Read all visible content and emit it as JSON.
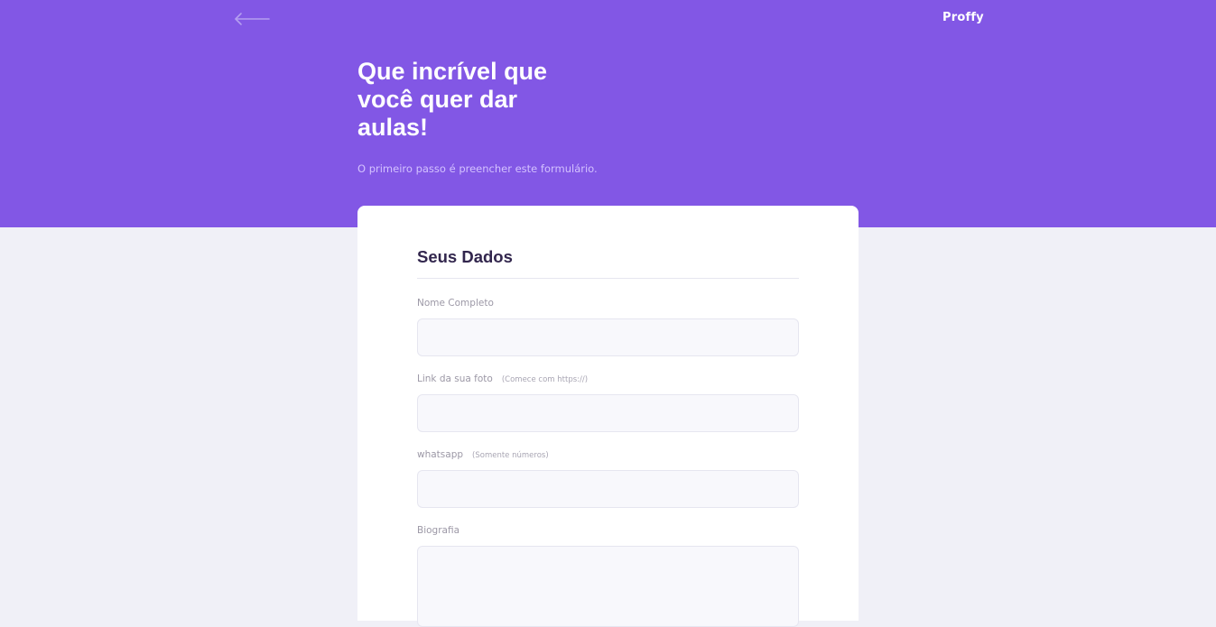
{
  "header": {
    "logo": "Proffy",
    "back_icon": "arrow-left-icon",
    "title": "Que incrível que você quer dar aulas!",
    "subtitle": "O primeiro passo é preencher este formulário."
  },
  "form": {
    "legend": "Seus Dados",
    "fields": [
      {
        "label": "Nome Completo",
        "hint": "",
        "value": "",
        "placeholder": ""
      },
      {
        "label": "Link da sua foto",
        "hint": "(Comece com https://)",
        "value": "",
        "placeholder": ""
      },
      {
        "label": "whatsapp",
        "hint": "(Somente números)",
        "value": "",
        "placeholder": ""
      },
      {
        "label": "Biografia",
        "hint": "",
        "value": "",
        "placeholder": ""
      }
    ]
  },
  "colors": {
    "primary": "#8257e5",
    "background": "#f0f0f7",
    "card": "#ffffff",
    "title_in_primary": "#ffffff",
    "text_in_primary": "#d4c2ff",
    "text_title": "#32264d",
    "text_complement": "#9c98a6",
    "input_background": "#f8f8fc",
    "line_in_white": "#e6e6f0"
  }
}
